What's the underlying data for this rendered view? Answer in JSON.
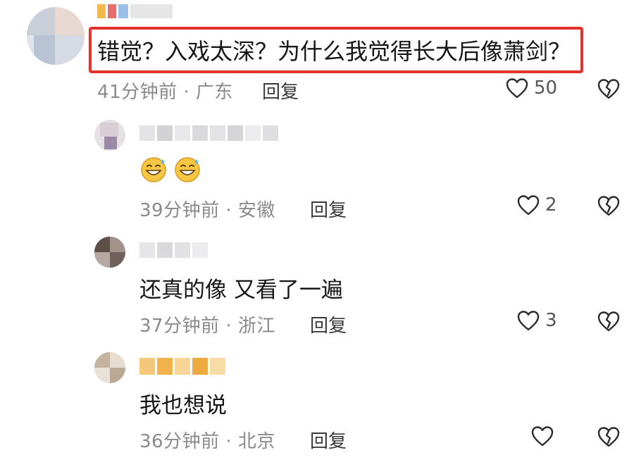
{
  "comments": [
    {
      "text": "错觉？入戏太深？为什么我觉得长大后像萧剑？",
      "meta": "41分钟前 · 广东",
      "reply": "回复",
      "likes": "50"
    },
    {
      "text": "",
      "meta": "39分钟前 · 安徽",
      "reply": "回复",
      "likes": "2"
    },
    {
      "text": "还真的像 又看了一遍",
      "meta": "37分钟前 · 浙江",
      "reply": "回复",
      "likes": "3"
    },
    {
      "text": "我也想说",
      "meta": "36分钟前 · 北京",
      "reply": "回复",
      "likes": ""
    }
  ],
  "icons": {
    "like": "heart-outline-icon",
    "dislike": "broken-heart-icon",
    "emoji": "grinning-sweat-emoji"
  },
  "colors": {
    "highlight_border": "#e5322d",
    "meta_text": "#8a8a8a",
    "icon_stroke": "#2b2b2b"
  }
}
